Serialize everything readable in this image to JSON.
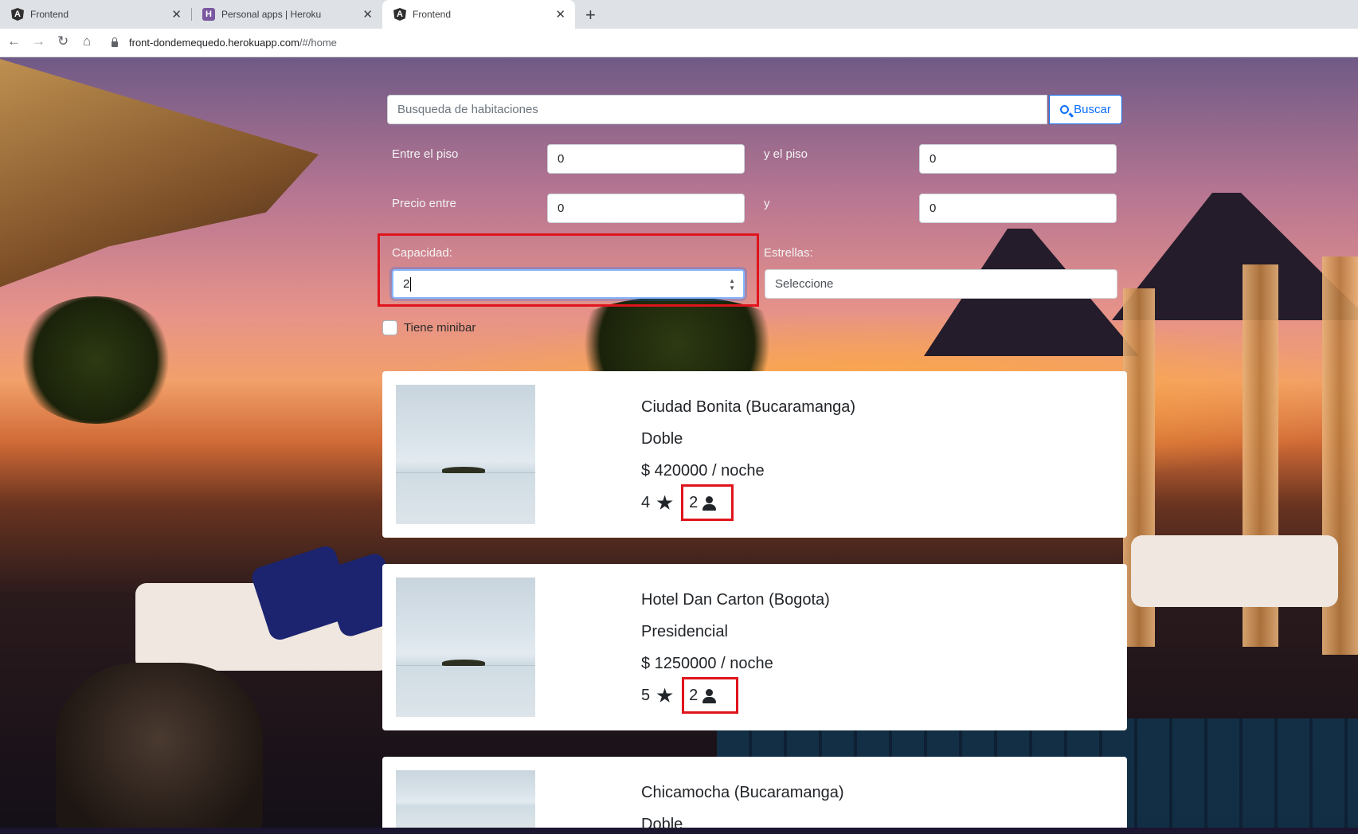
{
  "browser": {
    "tabs": [
      {
        "title": "Frontend",
        "favicon": "angular-icon",
        "active": false
      },
      {
        "title": "Personal apps | Heroku",
        "favicon": "heroku-icon",
        "active": false
      },
      {
        "title": "Frontend",
        "favicon": "angular-icon",
        "active": true
      }
    ],
    "url_host": "front-dondemequedo.herokuapp.com",
    "url_path": "/#/home",
    "favicon_letters": {
      "angular": "A",
      "heroku": "H"
    }
  },
  "search": {
    "placeholder": "Busqueda de habitaciones",
    "button_label": "Buscar"
  },
  "filters": {
    "floor_from_label": "Entre el piso",
    "floor_from_value": "0",
    "floor_to_label": "y el piso",
    "floor_to_value": "0",
    "price_from_label": "Precio entre",
    "price_from_value": "0",
    "price_to_label": "y",
    "price_to_value": "0",
    "capacity_label": "Capacidad:",
    "capacity_value": "2",
    "stars_label": "Estrellas:",
    "stars_selected": "Seleccione",
    "minibar_label": "Tiene minibar"
  },
  "rooms": [
    {
      "hotel": "Ciudad Bonita (Bucaramanga)",
      "type": "Doble",
      "price": "$ 420000 / noche",
      "stars": "4",
      "capacity": "2"
    },
    {
      "hotel": "Hotel Dan Carton (Bogota)",
      "type": "Presidencial",
      "price": "$ 1250000 / noche",
      "stars": "5",
      "capacity": "2"
    },
    {
      "hotel": "Chicamocha (Bucaramanga)",
      "type": "Doble",
      "price": "",
      "stars": "",
      "capacity": ""
    }
  ],
  "colors": {
    "highlight": "#e0141c",
    "accent": "#0d6efd"
  }
}
